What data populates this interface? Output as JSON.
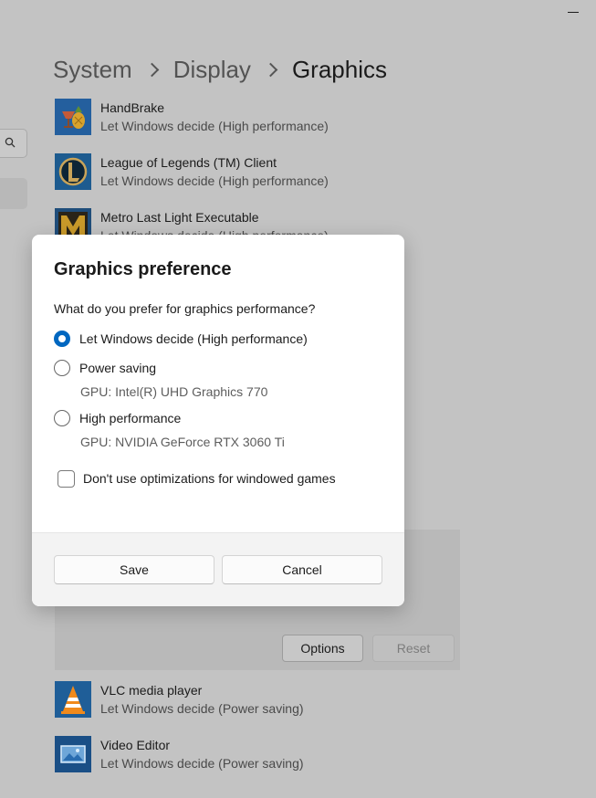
{
  "window": {
    "minimize_icon": "minimize-icon"
  },
  "breadcrumb": {
    "items": [
      "System",
      "Display",
      "Graphics"
    ]
  },
  "sidebar": {
    "search_icon": "search-icon"
  },
  "apps": [
    {
      "name": "HandBrake",
      "preference": "Let Windows decide (High performance)",
      "icon": "handbrake-icon"
    },
    {
      "name": "League of Legends (TM) Client",
      "preference": "Let Windows decide (High performance)",
      "icon": "league-of-legends-icon"
    },
    {
      "name": "Metro Last Light Executable",
      "preference": "Let Windows decide (High performance)",
      "icon": "metro-last-light-icon"
    },
    {
      "name": "VLC media player",
      "preference": "Let Windows decide (Power saving)",
      "icon": "vlc-icon"
    },
    {
      "name": "Video Editor",
      "preference": "Let Windows decide (Power saving)",
      "icon": "video-editor-icon"
    }
  ],
  "expanded_card": {
    "options_label": "Options",
    "reset_label": "Reset"
  },
  "dialog": {
    "title": "Graphics preference",
    "question": "What do you prefer for graphics performance?",
    "options": [
      {
        "label": "Let Windows decide (High performance)",
        "gpu": "",
        "selected": true
      },
      {
        "label": "Power saving",
        "gpu": "GPU: Intel(R) UHD Graphics 770",
        "selected": false
      },
      {
        "label": "High performance",
        "gpu": "GPU: NVIDIA GeForce RTX 3060 Ti",
        "selected": false
      }
    ],
    "checkbox_label": "Don't use optimizations for windowed games",
    "checkbox_checked": false,
    "save_label": "Save",
    "cancel_label": "Cancel"
  },
  "colors": {
    "accent": "#0067c0",
    "overlay": "#c3c3c3",
    "dialog_bg": "#ffffff",
    "footer_bg": "#f3f3f3"
  }
}
